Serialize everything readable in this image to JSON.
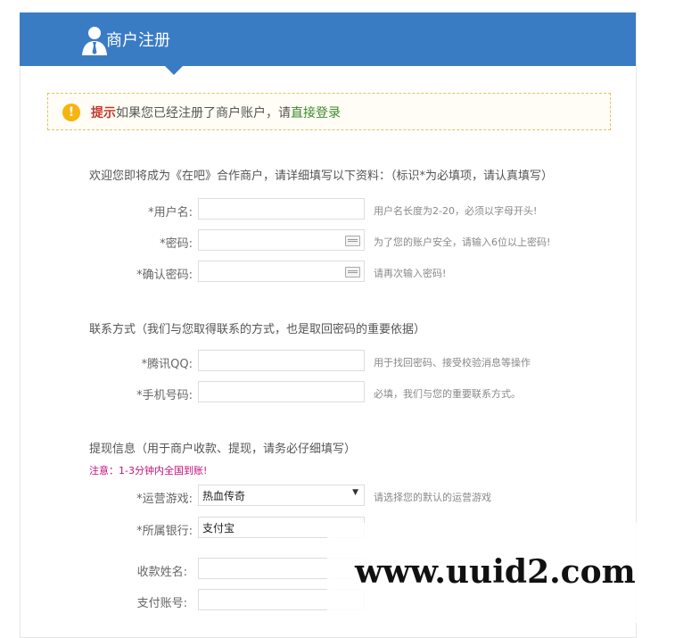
{
  "header": {
    "title": "商户注册"
  },
  "tip": {
    "label": "提示",
    "text": "如果您已经注册了商户账户，请",
    "link": "直接登录"
  },
  "section_account": "欢迎您即将成为《在吧》合作商户，请详细填写以下资料：（标识*为必填项，请认真填写）",
  "fields_account": [
    {
      "label": "*用户名:",
      "hint": "用户名长度为2-20，必须以字母开头!"
    },
    {
      "label": "*密码:",
      "hint": "为了您的账户安全，请输入6位以上密码!"
    },
    {
      "label": "*确认密码:",
      "hint": "请再次输入密码!"
    }
  ],
  "section_contact": "联系方式（我们与您取得联系的方式，也是取回密码的重要依据）",
  "fields_contact": [
    {
      "label": "*腾讯QQ:",
      "hint": "用于找回密码、接受校验消息等操作"
    },
    {
      "label": "*手机号码:",
      "hint": "必填，我们与您的重要联系方式。"
    }
  ],
  "section_withdraw": "提现信息（用于商户收款、提现，请务必仔细填写）",
  "note": "注意：1-3分钟内全国到账!",
  "fields_withdraw": [
    {
      "label": "*运营游戏:",
      "value": "热血传奇",
      "hint": "请选择您的默认的运营游戏"
    },
    {
      "label": "*所属银行:",
      "value": "支付宝"
    },
    {
      "label": "收款姓名:"
    },
    {
      "label": "支付账号:"
    }
  ],
  "watermark": "www.uuid2.com",
  "colors": {
    "header": "#3a7cc4",
    "tip_label": "#c0392b",
    "tip_link": "#3a8a2a",
    "note": "#c0117a"
  }
}
